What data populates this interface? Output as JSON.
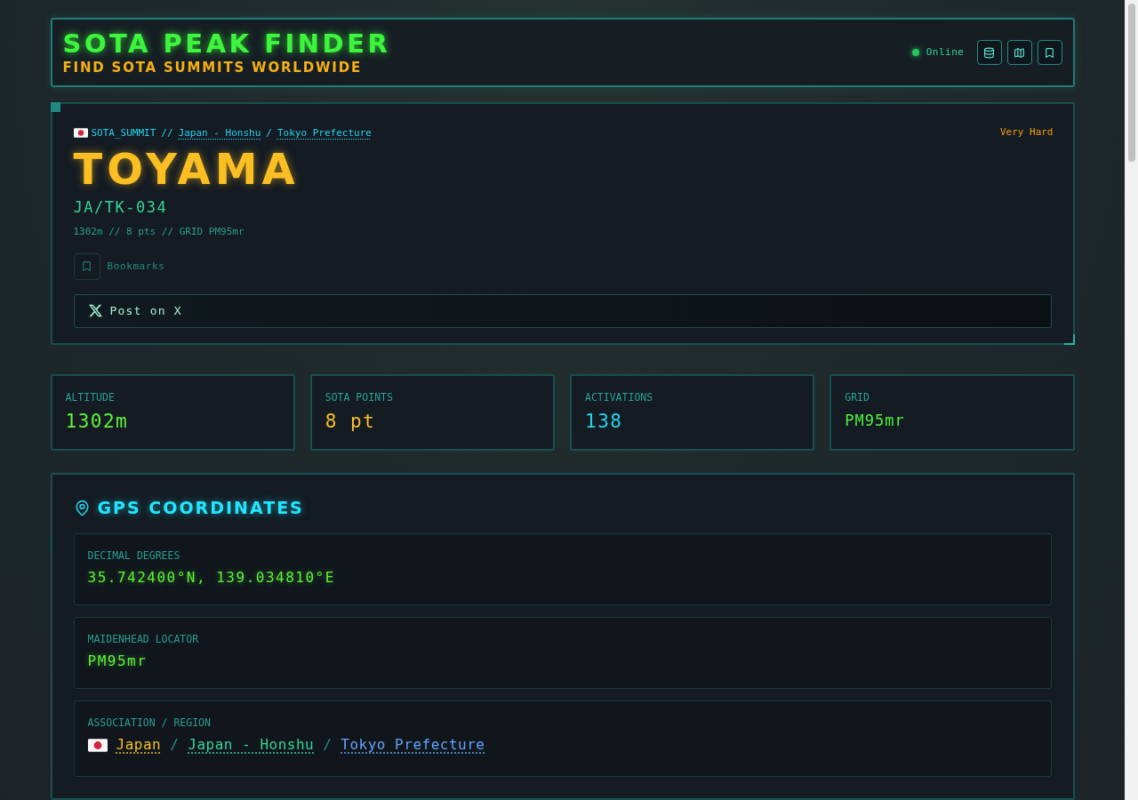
{
  "header": {
    "title": "SOTA PEAK FINDER",
    "subtitle": "FIND SOTA SUMMITS WORLDWIDE",
    "status": {
      "label": "Online",
      "online": true
    }
  },
  "summit": {
    "breadcrumb": [
      {
        "kind": "text",
        "text": "SOTA_SUMMIT"
      },
      {
        "kind": "separator",
        "text": "//"
      },
      {
        "kind": "link",
        "text": "Japan - Honshu"
      },
      {
        "kind": "separator",
        "text": "/"
      },
      {
        "kind": "link",
        "text": "Tokyo Prefecture"
      }
    ],
    "difficulty": "Very Hard",
    "name": "TOYAMA",
    "reference": "JA/TK-034",
    "details": "1302m // 8 pts // GRID PM95mr",
    "bookmark": {
      "label": "Bookmarks",
      "bookmarked": false
    },
    "share_button": "Post on X"
  },
  "stats": [
    {
      "kind": "number",
      "label": "ALTITUDE",
      "value": "1302m",
      "color": "#62f23c"
    },
    {
      "kind": "number",
      "label": "SOTA POINTS",
      "value": "8 pt",
      "color": "#fbbf24"
    },
    {
      "kind": "number",
      "label": "ACTIVATIONS",
      "value": "138",
      "color": "#22d3ee"
    },
    {
      "kind": "code",
      "label": "GRID",
      "value": "PM95mr",
      "color": "#4ff03c"
    }
  ],
  "gps": {
    "title": "GPS COORDINATES",
    "fields": [
      {
        "kind": "value",
        "label": "DECIMAL DEGREES",
        "value": "35.742400°N, 139.034810°E"
      },
      {
        "kind": "value",
        "label": "MAIDENHEAD LOCATOR",
        "value": "PM95mr"
      },
      {
        "kind": "links",
        "label": "ASSOCIATION / REGION",
        "parts": [
          {
            "kind": "link",
            "text": "Japan",
            "color": "#fbbf24"
          },
          {
            "kind": "separator",
            "text": "/"
          },
          {
            "kind": "link",
            "text": "Japan - Honshu",
            "color": "#34d399"
          },
          {
            "kind": "separator",
            "text": "/"
          },
          {
            "kind": "link",
            "text": "Tokyo Prefecture",
            "color": "#60a5fa"
          }
        ]
      }
    ]
  }
}
